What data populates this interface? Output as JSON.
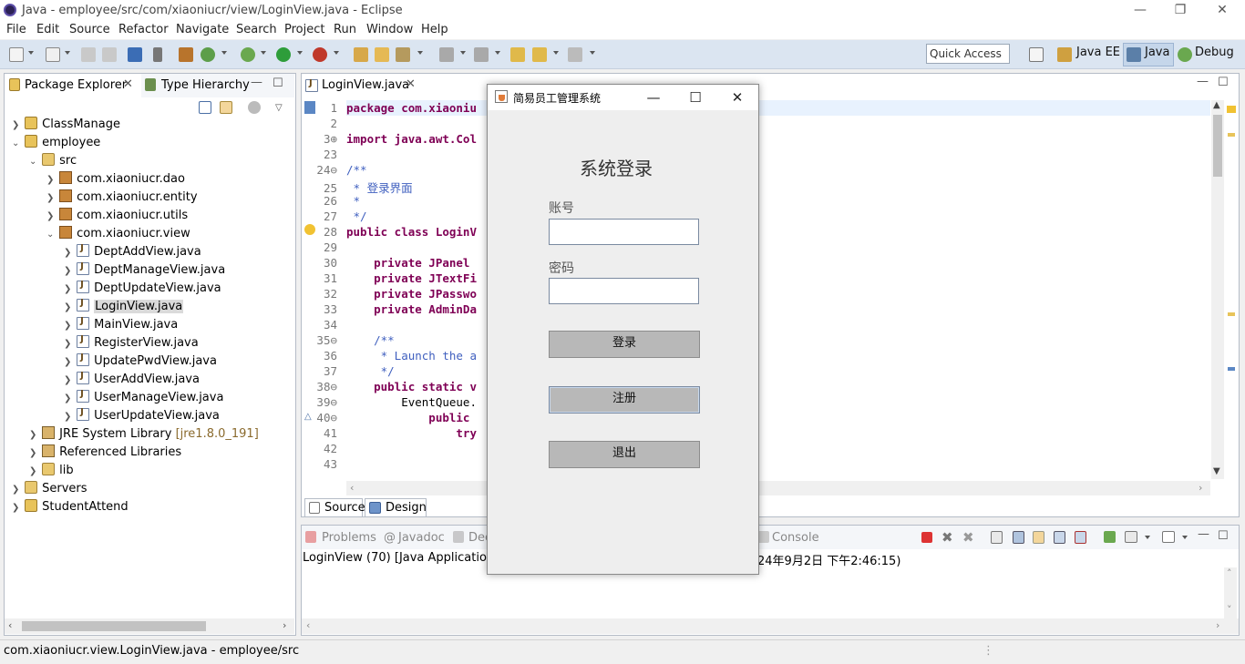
{
  "window": {
    "title": "Java - employee/src/com/xiaoniucr/view/LoginView.java - Eclipse",
    "minimize": "—",
    "restore": "❐",
    "close": "✕"
  },
  "menu": [
    "File",
    "Edit",
    "Source",
    "Refactor",
    "Navigate",
    "Search",
    "Project",
    "Run",
    "Window",
    "Help"
  ],
  "toolbar": {
    "quick_access": "Quick Access",
    "perspectives": [
      "Java EE",
      "Java",
      "Debug"
    ],
    "active_perspective": "Java"
  },
  "package_explorer": {
    "tab_label": "Package Explorer",
    "type_hierarchy_label": "Type Hierarchy",
    "tree": [
      {
        "label": "ClassManage",
        "icon": "project-icon",
        "expanded": false
      },
      {
        "label": "employee",
        "icon": "project-icon",
        "expanded": true
      },
      {
        "label": "src",
        "icon": "src-folder-icon",
        "expanded": true
      },
      {
        "label": "com.xiaoniucr.dao",
        "icon": "package-icon",
        "expanded": false
      },
      {
        "label": "com.xiaoniucr.entity",
        "icon": "package-icon",
        "expanded": false
      },
      {
        "label": "com.xiaoniucr.utils",
        "icon": "package-icon",
        "expanded": false
      },
      {
        "label": "com.xiaoniucr.view",
        "icon": "package-icon",
        "expanded": true
      },
      {
        "label": "DeptAddView.java",
        "icon": "java-file-icon"
      },
      {
        "label": "DeptManageView.java",
        "icon": "java-file-icon"
      },
      {
        "label": "DeptUpdateView.java",
        "icon": "java-file-icon"
      },
      {
        "label": "LoginView.java",
        "icon": "java-file-icon",
        "selected": true
      },
      {
        "label": "MainView.java",
        "icon": "java-file-icon"
      },
      {
        "label": "RegisterView.java",
        "icon": "java-file-icon"
      },
      {
        "label": "UpdatePwdView.java",
        "icon": "java-file-icon"
      },
      {
        "label": "UserAddView.java",
        "icon": "java-file-icon"
      },
      {
        "label": "UserManageView.java",
        "icon": "java-file-icon"
      },
      {
        "label": "UserUpdateView.java",
        "icon": "java-file-icon"
      },
      {
        "label": "JRE System Library",
        "suffix": "[jre1.8.0_191]",
        "icon": "library-icon"
      },
      {
        "label": "Referenced Libraries",
        "icon": "library-icon"
      },
      {
        "label": "lib",
        "icon": "folder-icon"
      },
      {
        "label": "Servers",
        "icon": "project-icon"
      },
      {
        "label": "StudentAttend",
        "icon": "project-icon"
      }
    ]
  },
  "editor": {
    "tab_label": "LoginView.java",
    "bottom_tabs": [
      "Source",
      "Design"
    ],
    "lines": [
      {
        "n": "1",
        "code": "package com.xiaoniu"
      },
      {
        "n": "2",
        "code": ""
      },
      {
        "n": "3⊕",
        "code": "import java.awt.Col"
      },
      {
        "n": "23",
        "code": ""
      },
      {
        "n": "24⊖",
        "code": "/**"
      },
      {
        "n": "25",
        "code": " * 登录界面"
      },
      {
        "n": "26",
        "code": " *"
      },
      {
        "n": "27",
        "code": " */"
      },
      {
        "n": "28",
        "code": "public class LoginV"
      },
      {
        "n": "29",
        "code": ""
      },
      {
        "n": "30",
        "code": "    private JPanel "
      },
      {
        "n": "31",
        "code": "    private JTextFi"
      },
      {
        "n": "32",
        "code": "    private JPasswo"
      },
      {
        "n": "33",
        "code": "    private AdminDa"
      },
      {
        "n": "34",
        "code": ""
      },
      {
        "n": "35⊖",
        "code": "    /**"
      },
      {
        "n": "36",
        "code": "     * Launch the a"
      },
      {
        "n": "37",
        "code": "     */"
      },
      {
        "n": "38⊖",
        "code": "    public static v"
      },
      {
        "n": "39⊖",
        "code": "        EventQueue."
      },
      {
        "n": "40⊖",
        "code": "            public "
      },
      {
        "n": "41",
        "code": "                try"
      },
      {
        "n": "42",
        "code": ""
      },
      {
        "n": "43",
        "code": ""
      }
    ]
  },
  "console": {
    "tabs": [
      "Problems",
      "Javadoc",
      "Dec",
      "Console"
    ],
    "launch_left": "LoginView (70) [Java Application] C",
    "launch_right": "24年9月2日 下午2:46:15)"
  },
  "dialog": {
    "title": "简易员工管理系统",
    "heading": "系统登录",
    "account_label": "账号",
    "password_label": "密码",
    "account_value": "",
    "password_value": "",
    "login_button": "登录",
    "register_button": "注册",
    "exit_button": "退出"
  },
  "status_bar": {
    "text": "com.xiaoniucr.view.LoginView.java - employee/src"
  }
}
